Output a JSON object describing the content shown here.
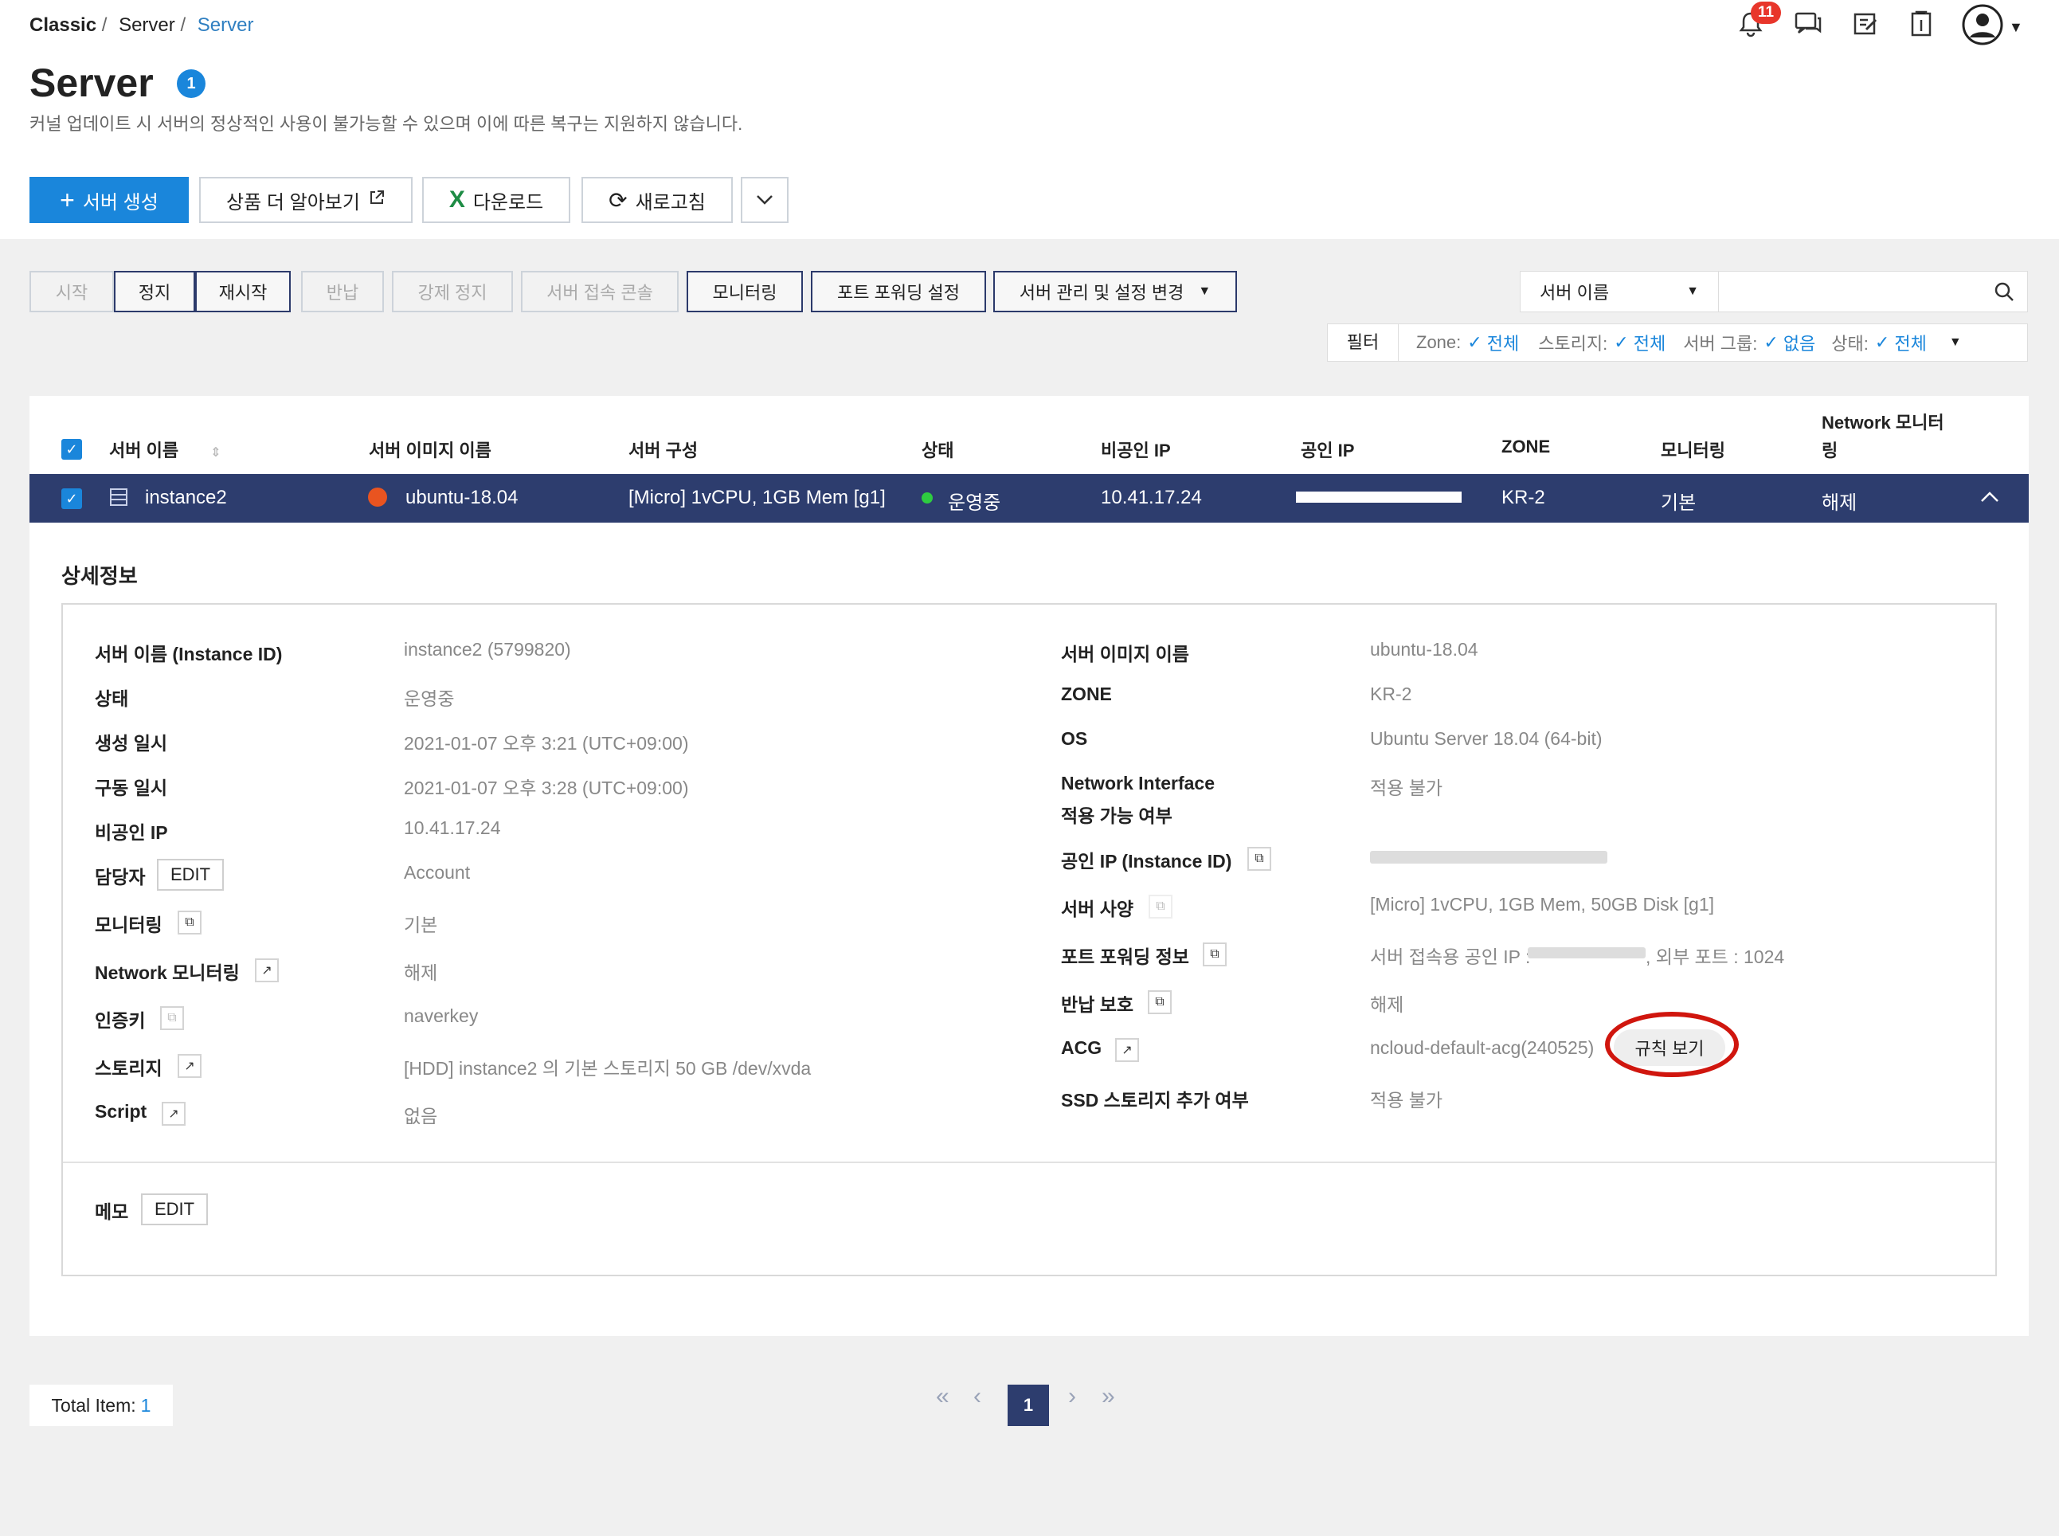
{
  "breadcrumb": {
    "root": "Classic",
    "mid": "Server",
    "current": "Server",
    "sep": "/"
  },
  "header": {
    "notif_count": "11",
    "title": "Server",
    "title_badge": "1",
    "subtitle": "커널 업데이트 시 서버의 정상적인 사용이 불가능할 수 있으며 이에 따른 복구는 지원하지 않습니다."
  },
  "toolbar": {
    "create_label": "서버 생성",
    "learn_more_label": "상품 더 알아보기",
    "download_label": "다운로드",
    "refresh_label": "새로고침"
  },
  "actions": {
    "start": "시작",
    "stop": "정지",
    "restart": "재시작",
    "return": "반납",
    "force_stop": "강제 정지",
    "console": "서버 접속 콘솔",
    "monitoring": "모니터링",
    "port_forwarding": "포트 포워딩 설정",
    "manage": "서버 관리 및 설정 변경"
  },
  "search": {
    "field": "서버 이름",
    "value": ""
  },
  "filter": {
    "label": "필터",
    "zone_label": "Zone:",
    "zone_value": "전체",
    "storage_label": "스토리지:",
    "storage_value": "전체",
    "group_label": "서버 그룹:",
    "group_value": "없음",
    "status_label": "상태:",
    "status_value": "전체"
  },
  "table": {
    "columns": {
      "name": "서버 이름",
      "image": "서버 이미지 이름",
      "spec": "서버 구성",
      "status": "상태",
      "private_ip": "비공인 IP",
      "public_ip": "공인 IP",
      "zone": "ZONE",
      "monitoring": "모니터링",
      "net_monitoring_1": "Network 모니터",
      "net_monitoring_2": "링"
    },
    "row": {
      "name": "instance2",
      "image": "ubuntu-18.04",
      "spec": "[Micro] 1vCPU, 1GB Mem [g1]",
      "status": "운영중",
      "private_ip": "10.41.17.24",
      "zone": "KR-2",
      "monitoring": "기본",
      "net_monitoring": "해제"
    }
  },
  "detail": {
    "title": "상세정보",
    "left": {
      "name_label": "서버 이름 (Instance ID)",
      "name_value": "instance2 (5799820)",
      "status_label": "상태",
      "status_value": "운영중",
      "created_label": "생성 일시",
      "created_value": "2021-01-07 오후 3:21 (UTC+09:00)",
      "started_label": "구동 일시",
      "started_value": "2021-01-07 오후 3:28 (UTC+09:00)",
      "private_ip_label": "비공인 IP",
      "private_ip_value": "10.41.17.24",
      "owner_label": "담당자",
      "owner_edit": "EDIT",
      "owner_value": "Account",
      "monitoring_label": "모니터링",
      "monitoring_value": "기본",
      "net_monitoring_label": "Network 모니터링",
      "net_monitoring_value": "해제",
      "authkey_label": "인증키",
      "authkey_value": "naverkey",
      "storage_label": "스토리지",
      "storage_value": "[HDD] instance2 의 기본 스토리지  50 GB /dev/xvda",
      "script_label": "Script",
      "script_value": "없음"
    },
    "right": {
      "image_label": "서버 이미지 이름",
      "image_value": "ubuntu-18.04",
      "zone_label": "ZONE",
      "zone_value": "KR-2",
      "os_label": "OS",
      "os_value": "Ubuntu Server 18.04 (64-bit)",
      "ni_label_1": "Network Interface",
      "ni_label_2": "적용 가능 여부",
      "ni_value": "적용 불가",
      "public_ip_label": "공인 IP (Instance ID)",
      "spec_label": "서버 사양",
      "spec_value": "[Micro] 1vCPU, 1GB Mem, 50GB Disk [g1]",
      "pf_label": "포트 포워딩 정보",
      "pf_value_prefix": "서버 접속용 공인 IP :",
      "pf_value_suffix": ", 외부 포트 : 1024",
      "return_protect_label": "반납 보호",
      "return_protect_value": "해제",
      "acg_label": "ACG",
      "acg_value": "ncloud-default-acg(240525)",
      "acg_button": "규칙 보기",
      "ssd_label": "SSD 스토리지 추가 여부",
      "ssd_value": "적용 불가"
    },
    "memo_label": "메모",
    "memo_edit": "EDIT"
  },
  "footer": {
    "total_label": "Total Item:",
    "total_value": "1",
    "page": "1"
  }
}
